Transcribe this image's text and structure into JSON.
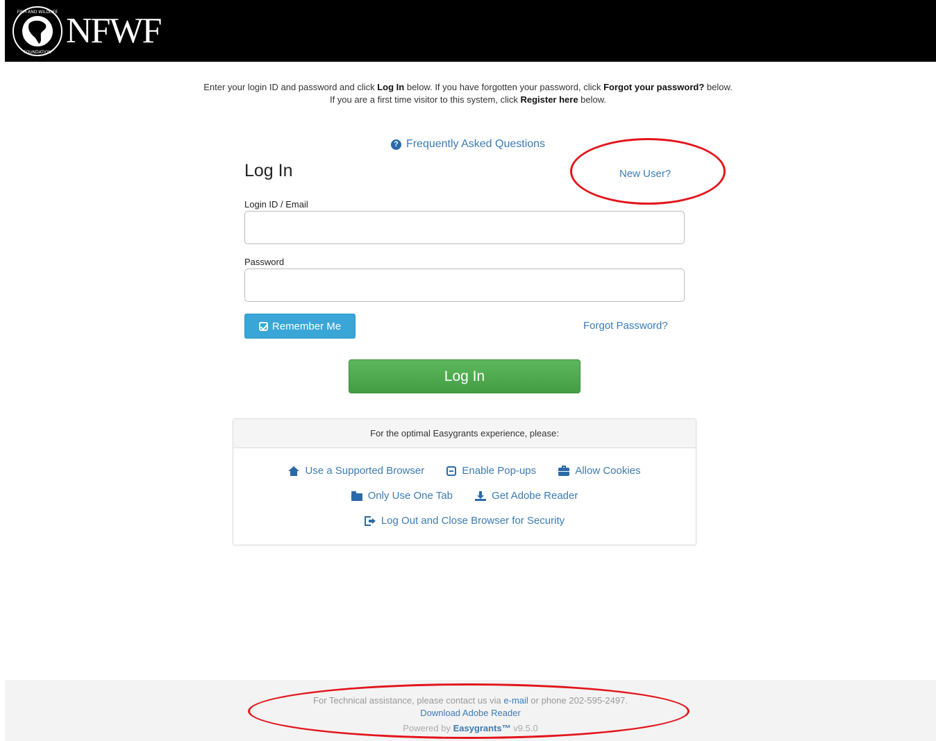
{
  "header": {
    "logo_text": "NFWF",
    "seal_text": "NATIONAL FISH AND WILDLIFE FOUNDATION"
  },
  "intro": {
    "line1_a": "Enter your login ID and password and click ",
    "line1_b": "Log In",
    "line1_c": " below. If you have forgotten your password, click ",
    "line1_d": "Forgot your password?",
    "line1_e": " below.",
    "line2_a": "If you are a first time visitor to this system, click ",
    "line2_b": "Register here",
    "line2_c": " below."
  },
  "faq": {
    "label": "Frequently Asked Questions"
  },
  "login": {
    "title": "Log In",
    "new_user": "New User?",
    "login_id_label": "Login ID / Email",
    "password_label": "Password",
    "login_id_value": "",
    "password_value": "",
    "remember_me": "Remember Me",
    "forgot_password": "Forgot Password?",
    "submit": "Log In"
  },
  "info_panel": {
    "header": "For the optimal Easygrants experience, please:",
    "items": [
      {
        "label": "Use a Supported Browser",
        "icon": "home-icon"
      },
      {
        "label": "Enable Pop-ups",
        "icon": "popup-window-icon"
      },
      {
        "label": "Allow Cookies",
        "icon": "briefcase-icon"
      },
      {
        "label": "Only Use One Tab",
        "icon": "folder-icon"
      },
      {
        "label": "Get Adobe Reader",
        "icon": "download-icon"
      },
      {
        "label": "Log Out and Close Browser for Security",
        "icon": "logout-icon"
      }
    ]
  },
  "footer": {
    "tech_a": "For Technical assistance, please contact us via ",
    "tech_email": "e-mail",
    "tech_b": " or phone 202-595-2497.",
    "download": "Download Adobe Reader",
    "powered_a": "Powered by ",
    "powered_brand": "Easygrants™",
    "powered_version": " v9.5.0"
  },
  "colors": {
    "link": "#3c7bb3",
    "remember_button": "#3aa6d8",
    "login_button": "#5cb85c",
    "annotation_circle": "#e3141b",
    "header_bg": "#000000"
  }
}
